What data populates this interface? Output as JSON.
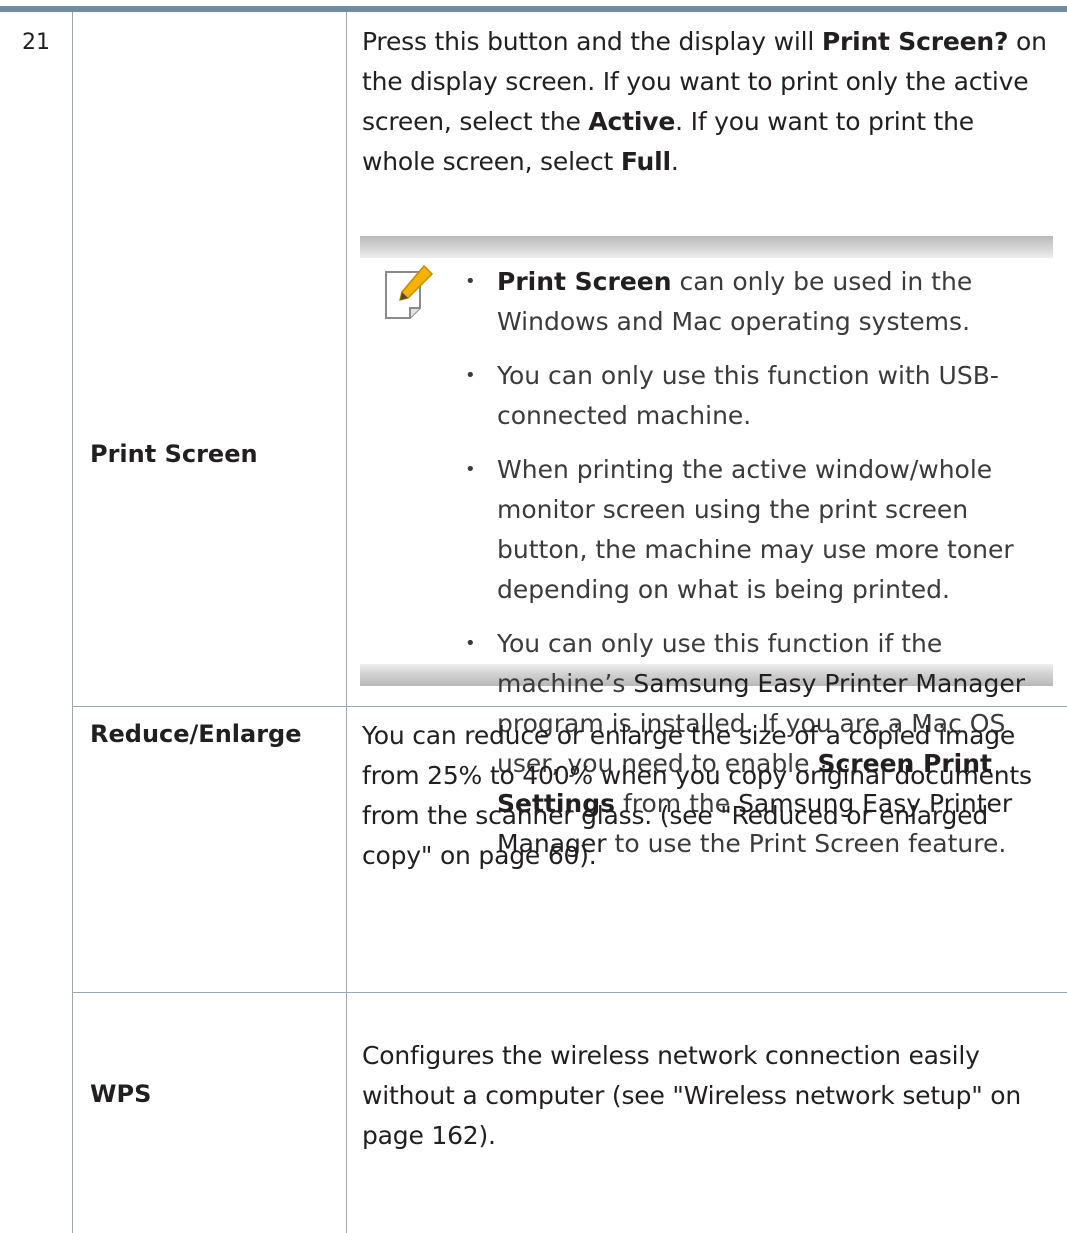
{
  "rows": [
    {
      "number": "21",
      "label": "Print Screen",
      "description": {
        "t1": "Press this button and the display will ",
        "b1": "Print Screen?",
        "t2": " on the display screen. If you want to print only the active screen, select the ",
        "b2": "Active",
        "t3": ". If you want to print the whole screen, select ",
        "b3": "Full",
        "t4": "."
      },
      "note": {
        "icon": "note-pencil-icon",
        "items": [
          {
            "b": "Print Screen",
            "t": " can only be used in the Windows and Mac operating systems."
          },
          {
            "t": "You can only use this function with USB-connected machine."
          },
          {
            "t": "When printing the active window/whole monitor screen using the print screen button, the machine may use more toner depending on what is being printed."
          },
          {
            "t1": "You can only use this function if the machine’s ",
            "d1": "Samsung Easy Printer Manager",
            "t2": " program is installed. If you are a Mac OS user, you need to enable ",
            "b1": "Screen Print Settings",
            "t3": " from the ",
            "d2": "Samsung Easy Printer Manager",
            "t4": " to use the Print Screen feature."
          }
        ]
      }
    },
    {
      "label": "Reduce/Enlarge",
      "description": "You can reduce or enlarge the size of a copied image from 25% to 400% when you copy original documents from the scanner glass. (see \"Reduced or enlarged copy\" on page 60)."
    },
    {
      "label": "WPS",
      "description": "Configures the wireless network connection easily without a computer (see \"Wireless network setup\" on page 162)."
    }
  ],
  "colors": {
    "accent_bar": "#6f8ea5",
    "rule": "#9aa7b2",
    "text": "#231f20"
  }
}
